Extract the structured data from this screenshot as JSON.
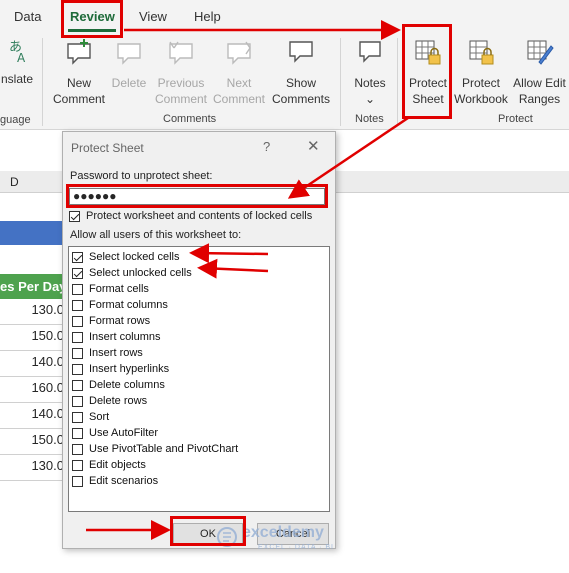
{
  "ribbon_tabs": [
    "Data",
    "Review",
    "View",
    "Help"
  ],
  "ribbon": {
    "translate_label": "nslate",
    "language_group": "guage",
    "comments_buttons": [
      {
        "l1": "New",
        "l2": "Comment",
        "icon": "new-comment-icon"
      },
      {
        "l1": "Delete",
        "l2": "",
        "icon": "delete-comment-icon"
      },
      {
        "l1": "Previous",
        "l2": "Comment",
        "icon": "previous-comment-icon"
      },
      {
        "l1": "Next",
        "l2": "Comment",
        "icon": "next-comment-icon"
      },
      {
        "l1": "Show",
        "l2": "Comments",
        "icon": "show-comments-icon"
      }
    ],
    "comments_group": "Comments",
    "notes_label": "Notes",
    "notes_chevron": "⌄",
    "notes_group": "Notes",
    "protect_buttons": [
      {
        "l1": "Protect",
        "l2": "Sheet",
        "icon": "protect-sheet-icon"
      },
      {
        "l1": "Protect",
        "l2": "Workbook",
        "icon": "protect-workbook-icon"
      },
      {
        "l1": "Allow Edit",
        "l2": "Ranges",
        "icon": "allow-edit-ranges-icon"
      }
    ],
    "protect_group": "Protect"
  },
  "sheet": {
    "col_header": "D",
    "col_title": "es Per Day",
    "values": [
      "130.0",
      "150.0",
      "140.0",
      "160.0",
      "140.0",
      "150.0",
      "130.0"
    ]
  },
  "dialog": {
    "title": "Protect Sheet",
    "help": "?",
    "close": "✕",
    "pw_label": "Password to unprotect sheet:",
    "pw_value": "●●●●●●",
    "protect_check_label": "Protect worksheet and contents of locked cells",
    "allow_label": "Allow all users of this worksheet to:",
    "options": [
      {
        "label": "Select locked cells",
        "checked": true
      },
      {
        "label": "Select unlocked cells",
        "checked": true
      },
      {
        "label": "Format cells",
        "checked": false
      },
      {
        "label": "Format columns",
        "checked": false
      },
      {
        "label": "Format rows",
        "checked": false
      },
      {
        "label": "Insert columns",
        "checked": false
      },
      {
        "label": "Insert rows",
        "checked": false
      },
      {
        "label": "Insert hyperlinks",
        "checked": false
      },
      {
        "label": "Delete columns",
        "checked": false
      },
      {
        "label": "Delete rows",
        "checked": false
      },
      {
        "label": "Sort",
        "checked": false
      },
      {
        "label": "Use AutoFilter",
        "checked": false
      },
      {
        "label": "Use PivotTable and PivotChart",
        "checked": false
      },
      {
        "label": "Edit objects",
        "checked": false
      },
      {
        "label": "Edit scenarios",
        "checked": false
      }
    ],
    "ok": "OK",
    "cancel": "Cancel"
  },
  "watermark": {
    "name": "exceldemy",
    "tagline": "EXCEL · DATA · BI"
  },
  "colors": {
    "annotation_red": "#e00000",
    "header_green": "#4ea24e",
    "header_blue": "#4472c4"
  }
}
